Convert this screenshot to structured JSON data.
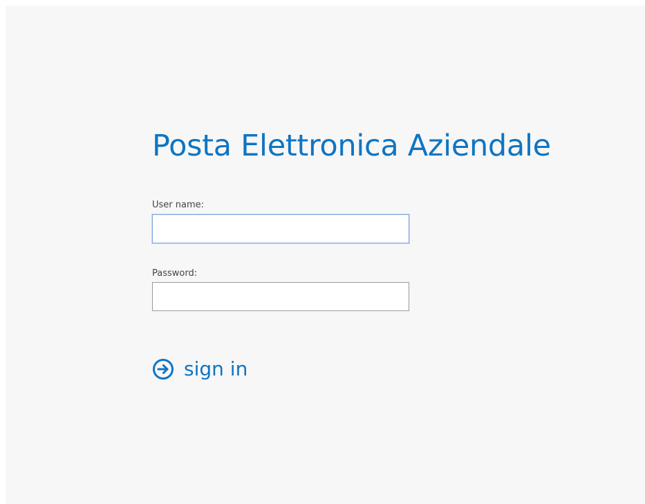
{
  "login": {
    "title": "Posta Elettronica Aziendale",
    "username_label": "User name:",
    "username_value": "",
    "password_label": "Password:",
    "password_value": "",
    "signin_label": "sign in",
    "signin_icon": "arrow-circle-right-icon"
  },
  "colors": {
    "accent": "#0f75c2",
    "background": "#f7f7f7"
  }
}
